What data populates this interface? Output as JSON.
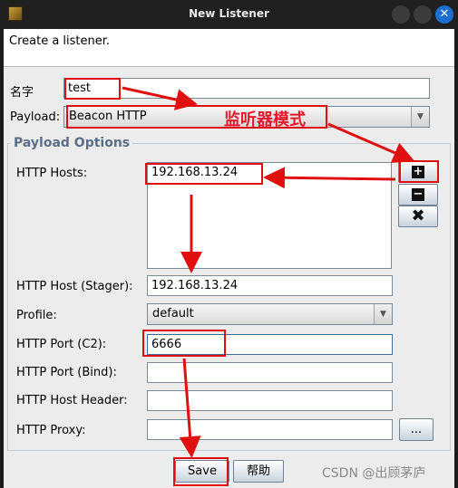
{
  "window": {
    "title": "New Listener",
    "close_glyph": "✕"
  },
  "intro": {
    "text": "Create a listener."
  },
  "form": {
    "name": {
      "label": "名字",
      "value": "test"
    },
    "payload": {
      "label": "Payload:",
      "value": "Beacon HTTP"
    },
    "options_title": "Payload Options",
    "hosts": {
      "label": "HTTP Hosts:",
      "items": [
        "192.168.13.24"
      ]
    },
    "host_stager": {
      "label": "HTTP Host (Stager):",
      "value": "192.168.13.24"
    },
    "profile": {
      "label": "Profile:",
      "value": "default"
    },
    "port_c2": {
      "label": "HTTP Port (C2):",
      "value": "6666"
    },
    "port_bind": {
      "label": "HTTP Port (Bind):",
      "value": ""
    },
    "host_header": {
      "label": "HTTP Host Header:",
      "value": ""
    },
    "proxy": {
      "label": "HTTP Proxy:",
      "value": "",
      "browse_label": "..."
    }
  },
  "host_buttons": {
    "add": "+",
    "remove": "−",
    "clear": "✖"
  },
  "actions": {
    "save": "Save",
    "help": "帮助"
  },
  "annotation": {
    "text": "监听器模式",
    "color": "#e01010"
  },
  "watermark": "CSDN @出顾茅庐",
  "icons": [
    "app-icon",
    "plus-icon",
    "minus-icon",
    "x-icon",
    "chevron-down-icon"
  ]
}
